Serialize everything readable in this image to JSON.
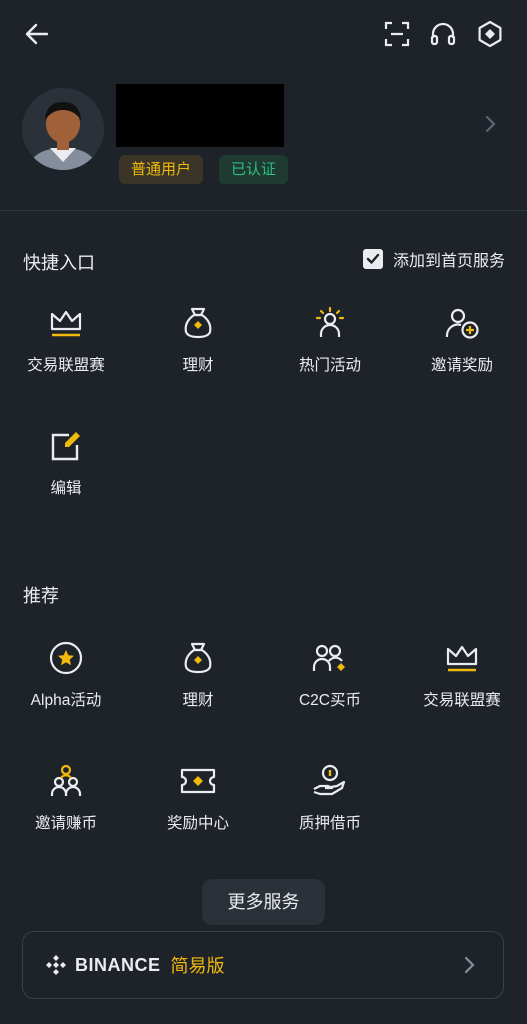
{
  "header": {
    "back_icon": "arrow-left-icon",
    "scan_icon": "scan-icon",
    "support_icon": "headset-icon",
    "settings_icon": "hexagon-settings-icon"
  },
  "profile": {
    "badge_user": "普通用户",
    "badge_verified": "已认证"
  },
  "shortcuts": {
    "title": "快捷入口",
    "add_to_home_label": "添加到首页服务",
    "add_to_home_checked": true,
    "items": [
      {
        "label": "交易联盟赛",
        "icon": "crown-icon"
      },
      {
        "label": "理财",
        "icon": "money-bag-icon"
      },
      {
        "label": "热门活动",
        "icon": "sun-person-icon"
      },
      {
        "label": "邀请奖励",
        "icon": "add-user-icon"
      },
      {
        "label": "编辑",
        "icon": "edit-icon"
      }
    ]
  },
  "recommended": {
    "title": "推荐",
    "items": [
      {
        "label": "Alpha活动",
        "icon": "star-circle-icon"
      },
      {
        "label": "理财",
        "icon": "money-bag-icon"
      },
      {
        "label": "C2C买币",
        "icon": "users-diamond-icon"
      },
      {
        "label": "交易联盟赛",
        "icon": "crown-icon"
      },
      {
        "label": "邀请赚币",
        "icon": "group-icon"
      },
      {
        "label": "奖励中心",
        "icon": "ticket-icon"
      },
      {
        "label": "质押借币",
        "icon": "hand-coin-icon"
      }
    ]
  },
  "more_button": "更多服务",
  "footer": {
    "brand": "BINANCE",
    "lite": "简易版"
  },
  "colors": {
    "background": "#1e2329",
    "accent": "#f0b90b",
    "success": "#2ebd85",
    "text": "#eaecef"
  }
}
